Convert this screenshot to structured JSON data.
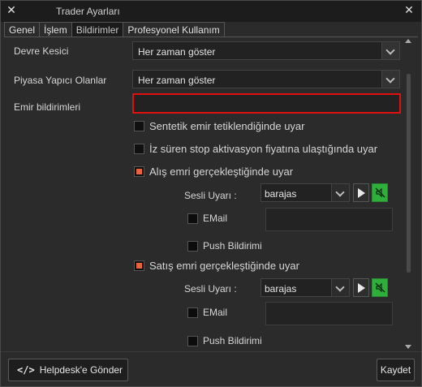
{
  "window": {
    "title": "Trader Ayarları",
    "close_glyph": "✕"
  },
  "tabs": [
    {
      "label": "Genel",
      "active": false
    },
    {
      "label": "İşlem",
      "active": false
    },
    {
      "label": "Bildirimler",
      "active": true
    },
    {
      "label": "Profesyonel Kullanım",
      "active": false
    }
  ],
  "settings": {
    "devre_kesici": {
      "label": "Devre Kesici",
      "value": "Her zaman göster"
    },
    "piyasa_yapici": {
      "label": "Piyasa Yapıcı Olanlar",
      "value": "Her zaman göster"
    },
    "emir_bildirimleri": {
      "label": "Emir bildirimleri",
      "value": ""
    }
  },
  "checks": {
    "sentetik": {
      "label": "Sentetik emir tetiklendiğinde uyar",
      "checked": false
    },
    "iz_suren": {
      "label": "İz süren stop aktivasyon fiyatına ulaştığında uyar",
      "checked": false
    },
    "alis": {
      "label": "Alış emri gerçekleştiğinde uyar",
      "checked": true
    },
    "satis": {
      "label": "Satış emri gerçekleştiğinde uyar",
      "checked": true
    }
  },
  "alis_options": {
    "sound_label": "Sesli Uyarı :",
    "sound_value": "barajas",
    "email_label": "EMail",
    "email_checked": false,
    "push_label": "Push Bildirimi",
    "push_checked": false
  },
  "satis_options": {
    "sound_label": "Sesli Uyarı :",
    "sound_value": "barajas",
    "email_label": "EMail",
    "email_checked": false,
    "push_label": "Push Bildirimi",
    "push_checked": false
  },
  "footer": {
    "helpdesk_icon": "</>",
    "helpdesk_label": "Helpdesk'e Gönder",
    "save_label": "Kaydet"
  },
  "colors": {
    "accent_checkbox": "#e8643c",
    "mute_button": "#2fae3c",
    "highlight_border": "#e01010"
  },
  "icons": [
    "close-icon",
    "chevron-down-icon",
    "play-icon",
    "mute-icon",
    "code-icon"
  ]
}
